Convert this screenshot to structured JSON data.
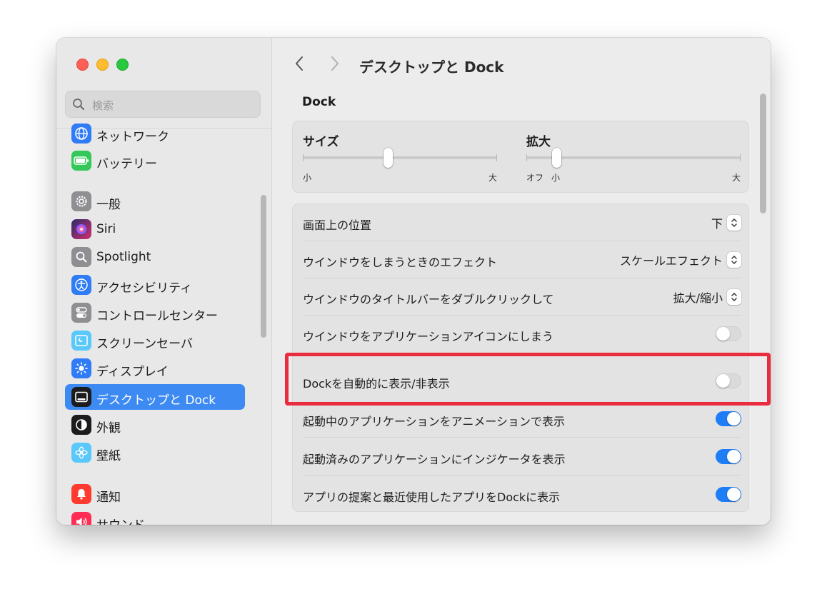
{
  "window": {
    "title": "デスクトップと Dock"
  },
  "search": {
    "placeholder": "検索"
  },
  "sidebar": {
    "items": [
      {
        "label": "ネットワーク",
        "icon": "globe-icon",
        "color": "#2f7cf6"
      },
      {
        "label": "バッテリー",
        "icon": "battery-icon",
        "color": "#34c759"
      },
      {
        "label": "一般",
        "icon": "gear-icon",
        "color": "#8e8e93"
      },
      {
        "label": "Siri",
        "icon": "siri-icon",
        "color": "#6b3fa0"
      },
      {
        "label": "Spotlight",
        "icon": "magnifier-icon",
        "color": "#8e8e93"
      },
      {
        "label": "アクセシビリティ",
        "icon": "accessibility-icon",
        "color": "#2f7cf6"
      },
      {
        "label": "コントロールセンター",
        "icon": "toggles-icon",
        "color": "#8e8e93"
      },
      {
        "label": "スクリーンセーバ",
        "icon": "screensaver-icon",
        "color": "#5ac8fa"
      },
      {
        "label": "ディスプレイ",
        "icon": "sun-icon",
        "color": "#2f7cf6"
      },
      {
        "label": "デスクトップと Dock",
        "icon": "dock-icon",
        "color": "#1c1c1e",
        "active": true
      },
      {
        "label": "外観",
        "icon": "appearance-icon",
        "color": "#1c1c1e"
      },
      {
        "label": "壁紙",
        "icon": "flower-icon",
        "color": "#5ac8fa"
      },
      {
        "label": "通知",
        "icon": "bell-icon",
        "color": "#ff3b30"
      },
      {
        "label": "サウンド",
        "icon": "speaker-icon",
        "color": "#ff2d55"
      }
    ]
  },
  "dock": {
    "section_title": "Dock",
    "size_slider": {
      "label": "サイズ",
      "min_label": "小",
      "max_label": "大",
      "value": 0.44
    },
    "magnify_slider": {
      "label": "拡大",
      "off_label": "オフ",
      "min_label": "小",
      "max_label": "大",
      "value": 0.14
    },
    "rows": [
      {
        "label": "画面上の位置",
        "type": "popup",
        "value": "下"
      },
      {
        "label": "ウインドウをしまうときのエフェクト",
        "type": "popup",
        "value": "スケールエフェクト"
      },
      {
        "label": "ウインドウのタイトルバーをダブルクリックして",
        "type": "popup",
        "value": "拡大/縮小"
      },
      {
        "label": "ウインドウをアプリケーションアイコンにしまう",
        "type": "toggle",
        "on": false
      },
      {
        "label": "Dockを自動的に表示/非表示",
        "type": "toggle",
        "on": false
      },
      {
        "label": "起動中のアプリケーションをアニメーションで表示",
        "type": "toggle",
        "on": true
      },
      {
        "label": "起動済みのアプリケーションにインジケータを表示",
        "type": "toggle",
        "on": true
      },
      {
        "label": "アプリの提案と最近使用したアプリをDockに表示",
        "type": "toggle",
        "on": true
      }
    ]
  },
  "colors": {
    "accent": "#3d8bf2",
    "toggle_on": "#1f7ef5",
    "highlight": "#ea2c3f"
  }
}
